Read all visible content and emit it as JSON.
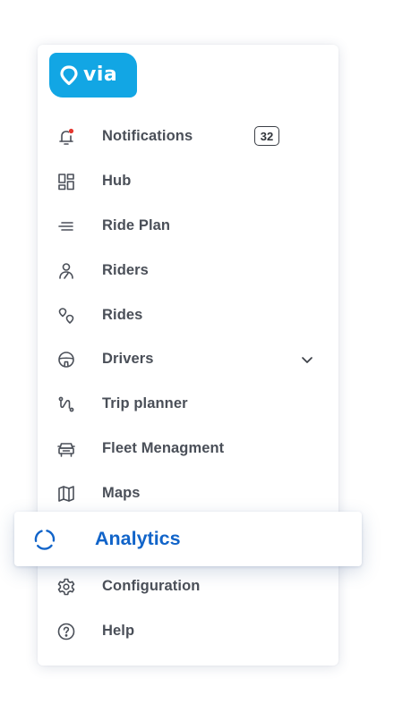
{
  "brand": {
    "name": "via",
    "color": "#12a6e4"
  },
  "nav": {
    "notifications": {
      "label": "Notifications",
      "count": "32",
      "icon": "bell-icon",
      "dot_color": "#e4372f"
    },
    "hub": {
      "label": "Hub",
      "icon": "dashboard-icon"
    },
    "ride_plan": {
      "label": "Ride Plan",
      "icon": "lines-icon"
    },
    "riders": {
      "label": "Riders",
      "icon": "user-icon"
    },
    "rides": {
      "label": "Rides",
      "icon": "route-pins-icon"
    },
    "drivers": {
      "label": "Drivers",
      "icon": "steering-wheel-icon",
      "expand_icon": "chevron-down-icon"
    },
    "trip_planner": {
      "label": "Trip planner",
      "icon": "trip-route-icon"
    },
    "fleet": {
      "label": "Fleet Menagment",
      "icon": "car-icon"
    },
    "maps": {
      "label": "Maps",
      "icon": "map-icon"
    },
    "analytics": {
      "label": "Analytics",
      "icon": "analytics-ring-icon",
      "selected": true,
      "accent_color": "#1164c9"
    },
    "configuration": {
      "label": "Configuration",
      "icon": "gear-icon"
    },
    "help": {
      "label": "Help",
      "icon": "help-circle-icon"
    }
  },
  "colors": {
    "text": "#4a4f58",
    "icon": "#4a4f58",
    "accent": "#1164c9"
  }
}
